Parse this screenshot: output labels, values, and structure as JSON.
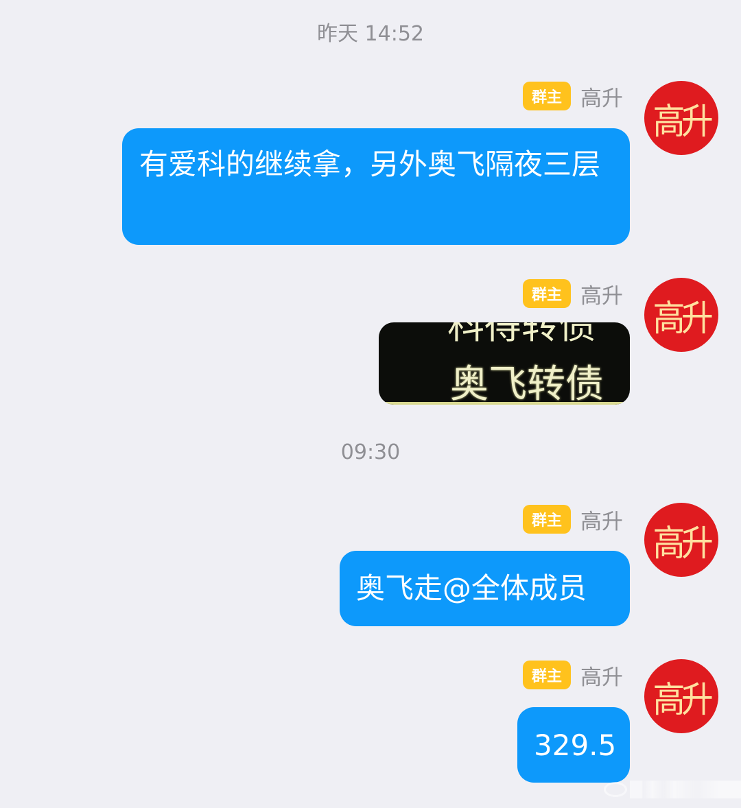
{
  "timestamps": [
    "昨天 14:52",
    "09:30"
  ],
  "sender": {
    "badge": "群主",
    "name": "高升",
    "avatar_text": "高升",
    "avatar_color": "#df1b1f",
    "badge_color": "#ffc21d"
  },
  "messages": [
    {
      "type": "text",
      "text": "有爱科的继续拿，另外奥飞隔夜三层"
    },
    {
      "type": "image",
      "line1": "科得转债",
      "line2": "奥飞转债"
    },
    {
      "type": "text",
      "text": "奥飞走@全体成员"
    },
    {
      "type": "text",
      "text": "329.5"
    }
  ],
  "colors": {
    "background": "#efeff4",
    "bubble": "#0d99fb",
    "timestamp_text": "#8f8f94"
  }
}
